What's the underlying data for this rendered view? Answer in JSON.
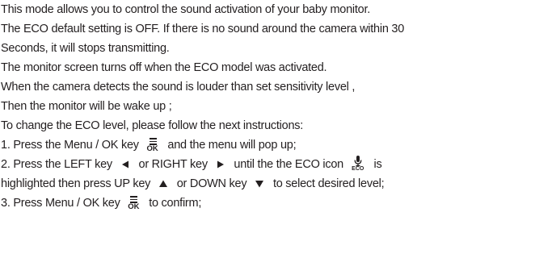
{
  "lines": {
    "l1": "This mode allows you to control the sound activation of your baby monitor.",
    "l2": "The ECO default setting is OFF. If there is no sound around the camera within 30",
    "l3": "Seconds, it will stops transmitting.",
    "l4": "The monitor screen turns off when the ECO model was activated.",
    "l5": "When the camera detects the sound is louder than set sensitivity level ,",
    "l6": "Then the monitor will be wake up ;",
    "l7": "To change the ECO level, please follow the next instructions:"
  },
  "step1": {
    "before": "1. Press the Menu / OK key",
    "after": "and the menu will pop up;"
  },
  "step2": {
    "part1": "2. Press the LEFT key",
    "part2": "or RIGHT key",
    "part3": "until the  the ECO icon",
    "part4": "is",
    "part5": "highlighted then press UP key",
    "part6": "or DOWN key",
    "part7": "to select desired level;"
  },
  "step3": {
    "before": "3. Press Menu / OK key",
    "after": "to confirm;"
  },
  "icons": {
    "ok_label": "OK",
    "eco_label": "ECO",
    "menu_ok": "menu-ok-icon",
    "left": "left-arrow-icon",
    "right": "right-arrow-icon",
    "up": "up-arrow-icon",
    "down": "down-arrow-icon",
    "eco": "eco-microphone-icon"
  },
  "colors": {
    "text": "#231f20",
    "background": "#ffffff"
  }
}
